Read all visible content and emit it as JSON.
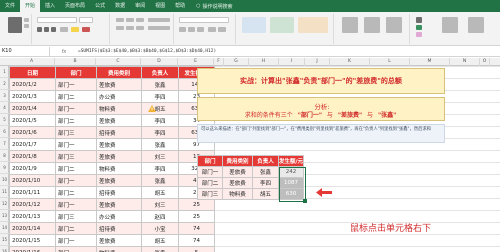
{
  "ribbon": {
    "tabs": [
      "文件",
      "开始",
      "插入",
      "页面布局",
      "公式",
      "数据",
      "审阅",
      "视图",
      "帮助"
    ],
    "active_tab": "开始",
    "tell_me": "操作说明搜索"
  },
  "formula_bar": {
    "name_box": "K10",
    "fx": "fx",
    "formula": "=SUMIFS($E$3:$E$40,$B$3:$B$40,$G$12,$D$3:$D$40,H12)"
  },
  "columns": [
    "A",
    "B",
    "C",
    "D",
    "E",
    "F",
    "G",
    "H",
    "I",
    "J",
    "K",
    "L",
    "M",
    "N",
    "O"
  ],
  "rows": [
    "1",
    "2",
    "3",
    "4",
    "5",
    "6",
    "7",
    "8",
    "9",
    "10",
    "11",
    "12",
    "13",
    "14",
    "15",
    "16"
  ],
  "main_table": {
    "headers": [
      "日期",
      "部门",
      "费用类别",
      "负责人",
      "发生额/元"
    ],
    "rows": [
      [
        "2020/1/2",
        "部门一",
        "差旅费",
        "张鑫",
        "145"
      ],
      [
        "2020/1/3",
        "部门二",
        "办公费",
        "李四",
        "23"
      ],
      [
        "2020/1/4",
        "部门一",
        "物料费",
        "胡五",
        "632"
      ],
      [
        "2020/1/5",
        "部门二",
        "差旅费",
        "李四",
        "34"
      ],
      [
        "2020/1/6",
        "部门三",
        "招待费",
        "李四",
        "633"
      ],
      [
        "2020/1/7",
        "部门一",
        "差旅费",
        "张鑫",
        "97"
      ],
      [
        "2020/1/8",
        "部门三",
        "差旅费",
        "刘三",
        "13"
      ],
      [
        "2020/1/9",
        "部门二",
        "物料费",
        "李四",
        "325"
      ],
      [
        "2020/1/10",
        "部门一",
        "差旅费",
        "张鑫",
        "42"
      ],
      [
        "2020/1/11",
        "部门二",
        "招待费",
        "胡五",
        "23"
      ],
      [
        "2020/1/12",
        "部门一",
        "差旅费",
        "刘三",
        "25"
      ],
      [
        "2020/1/13",
        "部门三",
        "办公费",
        "赵四",
        "25"
      ],
      [
        "2020/1/14",
        "部门二",
        "招待费",
        "小宝",
        "74"
      ],
      [
        "2020/1/15",
        "部门一",
        "差旅费",
        "胡五",
        "74"
      ],
      [
        "2020/1/16",
        "部门一",
        "物料费",
        "张鑫",
        "5"
      ]
    ]
  },
  "title_box": {
    "text": "实战：计算出\"张鑫\"负责\"部门一\"的\"差旅费\"的总额"
  },
  "analysis_box": {
    "title": "分析:",
    "lead": "求和的条件有三个",
    "cond1": "\"部门一\"",
    "joiner1": "与",
    "cond2": "\"差旅费\"",
    "joiner2": "与",
    "cond3": "\"张鑫\""
  },
  "note_box": {
    "text": "可以这么来描述：在\"部门\"列里找到\"部门一\"，在\"费用类别\"列里找到\"差旅费\"，再在\"负责人\"列里找到\"张鑫\"，然后求和"
  },
  "summary_table": {
    "headers": [
      "部门",
      "费用类别",
      "负责人",
      "发生额/元"
    ],
    "rows": [
      [
        "部门一",
        "差旅费",
        "张鑫",
        "242"
      ],
      [
        "部门二",
        "差旅费",
        "李四",
        "1087"
      ],
      [
        "部门三",
        "物料费",
        "胡五",
        "630"
      ]
    ]
  },
  "caption": "鼠标点击单元格右下",
  "colors": {
    "excel_green": "#217346",
    "header_red": "#e53935",
    "accent_red": "#d12a2a",
    "title_fill": "#fff2c4"
  }
}
